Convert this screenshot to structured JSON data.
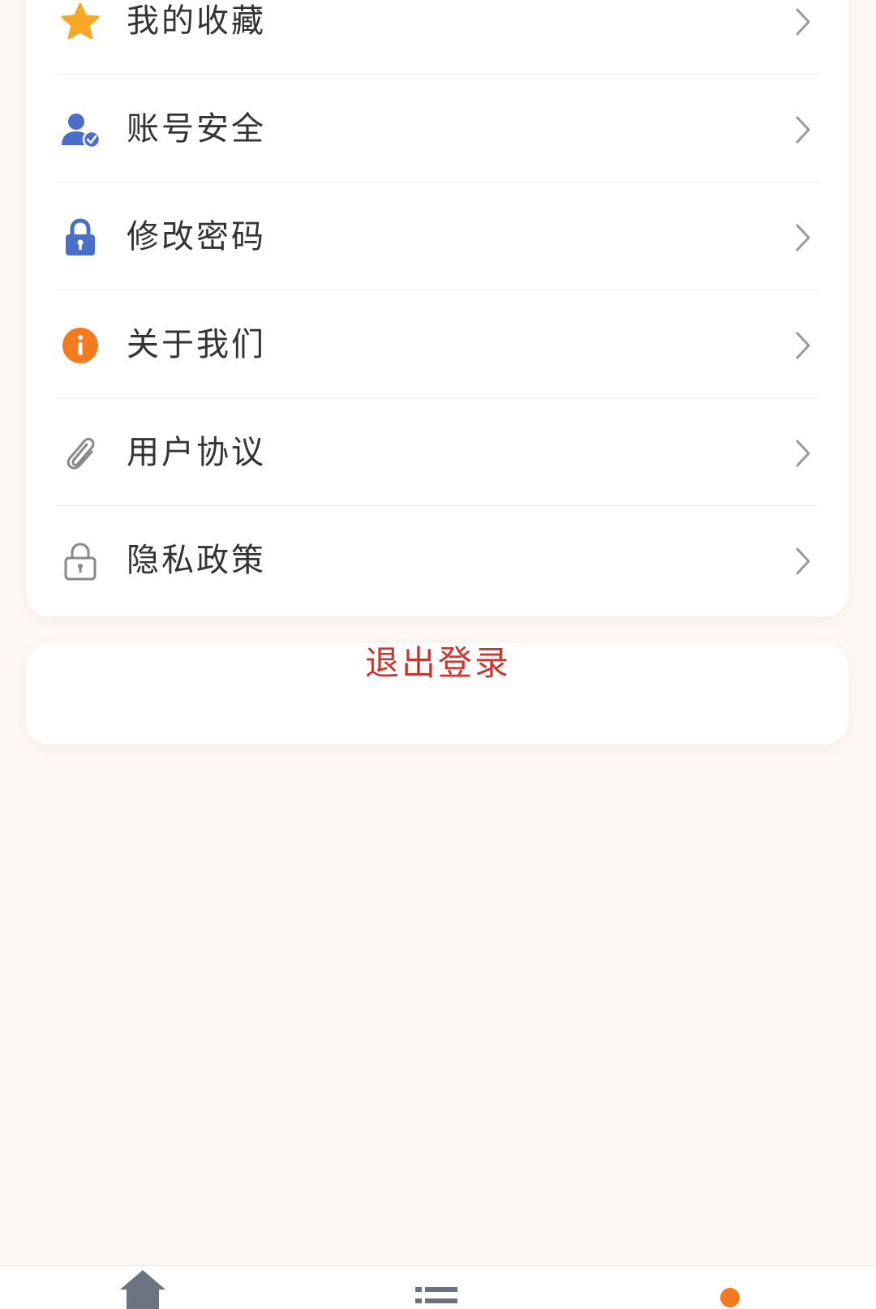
{
  "menu": {
    "items": [
      {
        "label": "我的收藏",
        "icon": "star-icon"
      },
      {
        "label": "账号安全",
        "icon": "user-verified-icon"
      },
      {
        "label": "修改密码",
        "icon": "lock-icon"
      },
      {
        "label": "关于我们",
        "icon": "info-icon"
      },
      {
        "label": "用户协议",
        "icon": "paperclip-icon"
      },
      {
        "label": "隐私政策",
        "icon": "lock-outline-icon"
      }
    ]
  },
  "logout": {
    "label": "退出登录"
  },
  "tab_bar": {
    "tabs": [
      {
        "icon": "home-icon"
      },
      {
        "icon": "list-icon"
      },
      {
        "icon": "profile-icon",
        "active": true
      }
    ]
  },
  "colors": {
    "background": "#fdf8f4",
    "card": "#ffffff",
    "text": "#333333",
    "logout_text": "#c8372f",
    "icon_blue": "#4a6fc8",
    "icon_orange": "#f47a20",
    "star_yellow": "#f9a825",
    "chevron": "#999999",
    "tab_gray": "#6b7280",
    "tab_active": "#f47a20"
  }
}
